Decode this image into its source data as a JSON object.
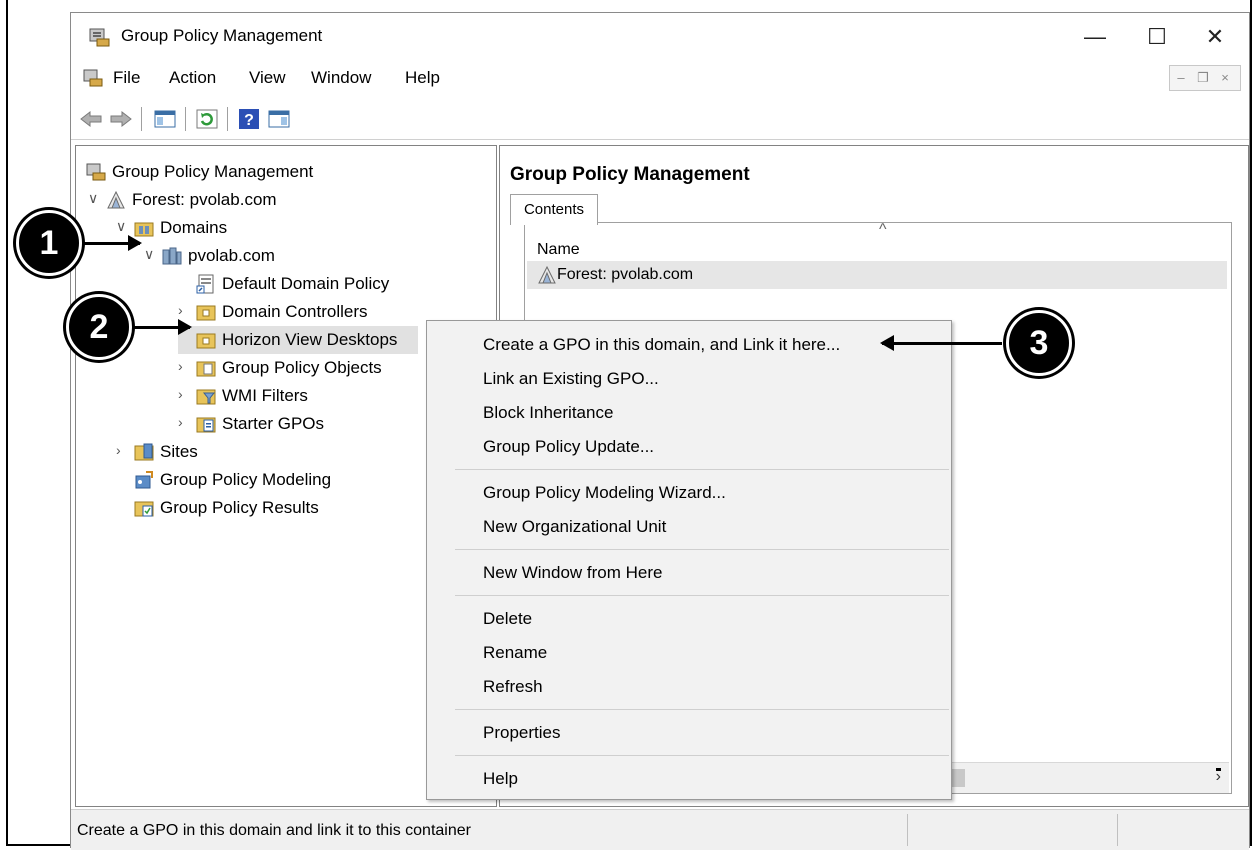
{
  "window": {
    "title": "Group Policy Management",
    "controls": {
      "minimize": "—",
      "maximize": "☐",
      "close": "✕"
    }
  },
  "menubar": {
    "items": [
      "File",
      "Action",
      "View",
      "Window",
      "Help"
    ],
    "mdi_controls": {
      "minimize": "–",
      "restore": "❐",
      "close": "×"
    }
  },
  "toolbar": {
    "buttons": [
      "back-arrow-icon",
      "forward-arrow-icon",
      "show-hide-console-tree-icon",
      "refresh-icon",
      "help-icon",
      "show-action-pane-icon"
    ]
  },
  "tree": {
    "items": [
      {
        "label": "Group Policy Management",
        "icon": "gpm-console-icon",
        "expand": ""
      },
      {
        "label": "Forest: pvolab.com",
        "icon": "forest-icon",
        "expand": "∨"
      },
      {
        "label": "Domains",
        "icon": "domains-folder-icon",
        "expand": "∨"
      },
      {
        "label": "pvolab.com",
        "icon": "domain-icon",
        "expand": "∨"
      },
      {
        "label": "Default Domain Policy",
        "icon": "gpo-link-icon",
        "expand": ""
      },
      {
        "label": "Domain Controllers",
        "icon": "ou-folder-icon",
        "expand": "›"
      },
      {
        "label": "Horizon View Desktops",
        "icon": "ou-folder-icon",
        "expand": "",
        "selected": true
      },
      {
        "label": "Group Policy Objects",
        "icon": "gpo-folder-icon",
        "expand": "›"
      },
      {
        "label": "WMI Filters",
        "icon": "wmi-folder-icon",
        "expand": "›"
      },
      {
        "label": "Starter GPOs",
        "icon": "starter-gpo-folder-icon",
        "expand": "›"
      },
      {
        "label": "Sites",
        "icon": "sites-icon",
        "expand": "›"
      },
      {
        "label": "Group Policy Modeling",
        "icon": "modeling-icon",
        "expand": ""
      },
      {
        "label": "Group Policy Results",
        "icon": "results-icon",
        "expand": ""
      }
    ]
  },
  "content": {
    "title": "Group Policy Management",
    "tab": "Contents",
    "column_header": "Name",
    "sort_indicator": "^",
    "rows": [
      {
        "name": "Forest: pvolab.com"
      }
    ],
    "scroll_right": "›"
  },
  "context_menu": {
    "items": [
      "Create a GPO in this domain, and Link it here...",
      "Link an Existing GPO...",
      "Block Inheritance",
      "Group Policy Update...",
      "Group Policy Modeling Wizard...",
      "New Organizational Unit",
      "New Window from Here",
      "Delete",
      "Rename",
      "Refresh",
      "Properties",
      "Help"
    ]
  },
  "status": {
    "text": "Create a GPO in this domain and link it to this container"
  },
  "callouts": [
    "1",
    "2",
    "3"
  ]
}
